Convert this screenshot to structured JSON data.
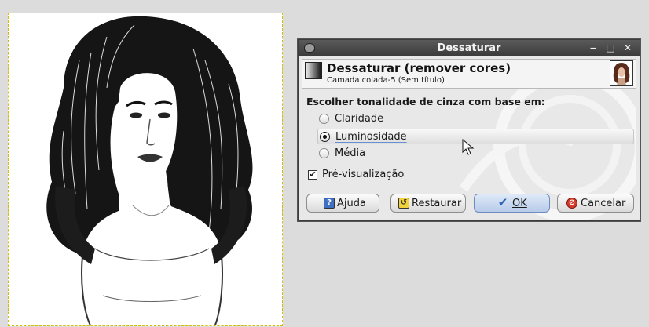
{
  "dialog": {
    "window_title": "Dessaturar",
    "header_title": "Dessaturar (remover cores)",
    "header_subtitle": "Camada colada-5 (Sem título)",
    "section_label": "Escolher tonalidade de cinza com base em:",
    "options": [
      {
        "label": "Claridade",
        "selected": false
      },
      {
        "label": "Luminosidade",
        "selected": true
      },
      {
        "label": "Média",
        "selected": false
      }
    ],
    "preview": {
      "label": "Pré-visualização",
      "checked": true
    },
    "buttons": {
      "help": "Ajuda",
      "reset": "Restaurar",
      "ok": "OK",
      "cancel": "Cancelar"
    }
  },
  "icons": {
    "app": "gimp-icon",
    "window": [
      "minimize-icon",
      "maximize-icon",
      "close-icon"
    ],
    "help": "help-icon",
    "reset": "reset-icon",
    "ok": "checkmark-icon",
    "cancel": "cancel-icon"
  }
}
